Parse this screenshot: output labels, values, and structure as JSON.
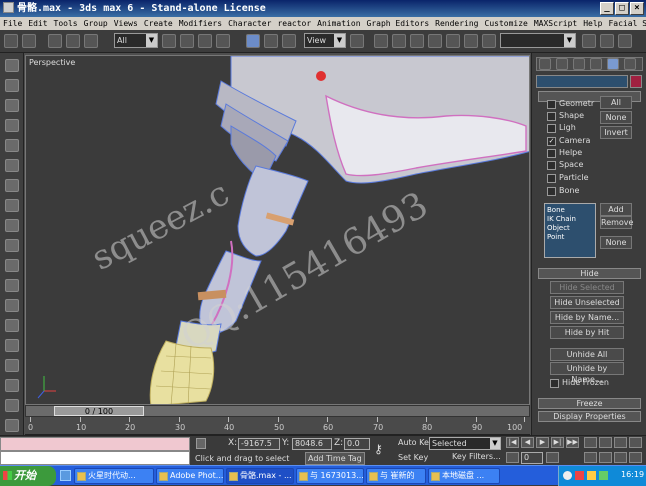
{
  "window": {
    "title": "骨骼.max - 3ds max 6 - Stand-alone License"
  },
  "menu": [
    "File",
    "Edit",
    "Tools",
    "Group",
    "Views",
    "Create",
    "Modifiers",
    "Character",
    "reactor",
    "Animation",
    "Graph Editors",
    "Rendering",
    "Customize",
    "MAXScript",
    "Help",
    "Facial Studio"
  ],
  "toolbar": {
    "filter_select": "All",
    "ref_coord": "View"
  },
  "viewport": {
    "label": "Perspective",
    "watermark_1": "squeez.c",
    "watermark_2": "QQ:115416493"
  },
  "timeline": {
    "slider": "0 / 100",
    "ticks": [
      "0",
      "10",
      "20",
      "30",
      "40",
      "50",
      "60",
      "70",
      "80",
      "90",
      "100"
    ]
  },
  "command_panel": {
    "hide_by_category": {
      "items": [
        {
          "label": "Geometr",
          "checked": false
        },
        {
          "label": "Shape",
          "checked": false
        },
        {
          "label": "Ligh",
          "checked": false
        },
        {
          "label": "Camera",
          "checked": true
        },
        {
          "label": "Helpe",
          "checked": false
        },
        {
          "label": "Space",
          "checked": false
        },
        {
          "label": "Particle",
          "checked": false
        },
        {
          "label": "Bone",
          "checked": false
        }
      ],
      "btn_all": "All",
      "btn_none": "None",
      "btn_invert": "Invert"
    },
    "list": [
      "Bone",
      "IK Chain Object",
      "Point"
    ],
    "btn_add": "Add",
    "btn_remove": "Remove",
    "btn_none2": "None",
    "hide_rollout": "Hide",
    "hide_buttons": [
      "Hide Selected",
      "Hide Unselected",
      "Hide by Name...",
      "Hide by Hit"
    ],
    "unhide_buttons": [
      "Unhide All",
      "Unhide by Name..."
    ],
    "hide_frozen": "Hide Frozen",
    "freeze_rollout": "Freeze",
    "display_props_rollout": "Display Properties"
  },
  "status": {
    "x_label": "X:",
    "x_value": "-9167.5",
    "y_label": "Y:",
    "y_value": "8048.6",
    "z_label": "Z:",
    "z_value": "0.0",
    "prompt": "Click and drag to select",
    "add_time_tag": "Add Time Tag",
    "auto_key": "Auto Key",
    "selected": "Selected",
    "set_key": "Set Key",
    "key_filters": "Key Filters...",
    "frame": "0"
  },
  "taskbar": {
    "start": "开始",
    "tasks": [
      "火星时代动...",
      "Adobe Phot...",
      "骨骼.max - ...",
      "与 1673013...",
      "与 崔新的",
      "本地磁盘 ..."
    ],
    "clock": "16:19"
  },
  "colors": {
    "titlebar": "#0a246a",
    "taskbar": "#245edb",
    "start": "#3c9a3c",
    "wire_blue": "#5a7adc",
    "wire_yellow": "#e0d070",
    "wire_pink": "#d070c0"
  }
}
